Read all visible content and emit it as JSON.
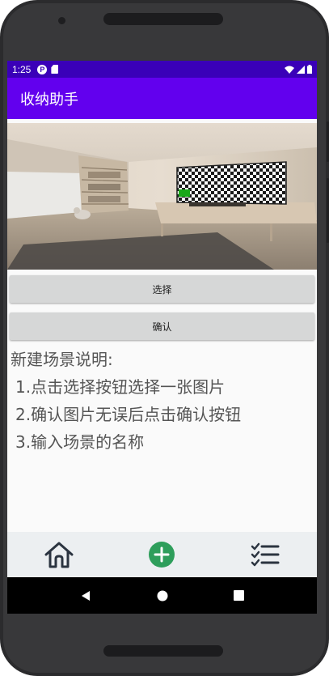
{
  "status_bar": {
    "time": "1:25"
  },
  "app_bar": {
    "title": "收纳助手"
  },
  "actions": {
    "select_label": "选择",
    "confirm_label": "确认"
  },
  "instructions": {
    "heading": "新建场景说明:",
    "steps": [
      "1.点击选择按钮选择一张图片",
      "2.确认图片无误后点击确认按钮",
      "3.输入场景的名称"
    ]
  },
  "bottom_nav": {
    "items": [
      {
        "icon": "home-icon"
      },
      {
        "icon": "add-circle-icon"
      },
      {
        "icon": "checklist-icon"
      }
    ]
  },
  "colors": {
    "status_bar": "#3a00b8",
    "app_bar": "#6200ee",
    "accent_green": "#2e9e5b",
    "button_bg": "#d6d7d7",
    "bottom_nav_bg": "#eceff1"
  }
}
